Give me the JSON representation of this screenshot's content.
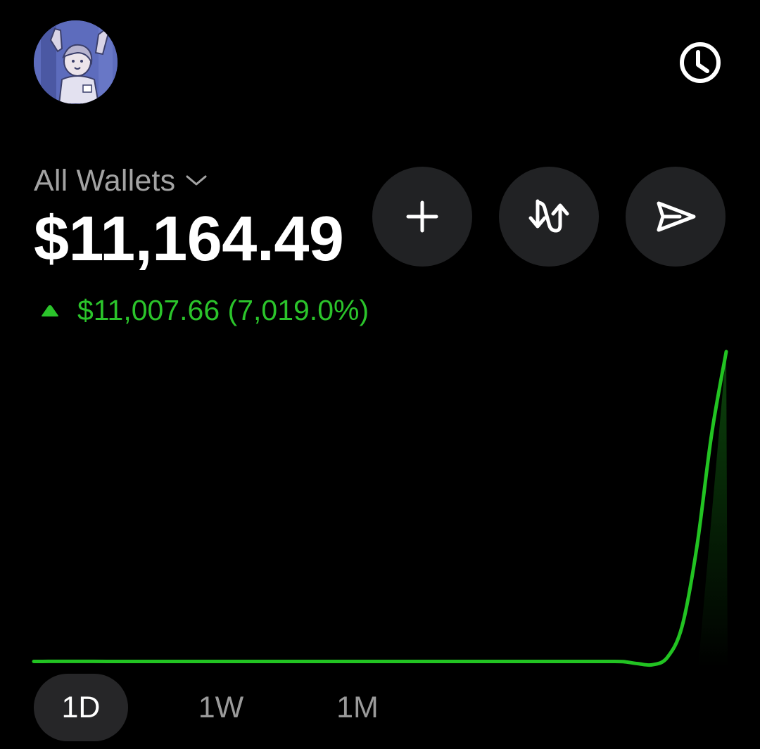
{
  "header": {
    "avatar_icon": "profile-avatar",
    "history_icon": "clock-icon"
  },
  "wallet": {
    "selector_label": "All Wallets",
    "selector_icon": "chevron-down-icon",
    "balance": "$11,164.49",
    "change_text": "$11,007.66 (7,019.0%)",
    "change_icon": "triangle-up-icon",
    "change_color": "#2bc42b"
  },
  "actions": [
    {
      "name": "add-button",
      "icon": "plus-icon"
    },
    {
      "name": "swap-button",
      "icon": "swap-arrows-icon"
    },
    {
      "name": "send-button",
      "icon": "send-icon"
    }
  ],
  "chart_data": {
    "type": "line",
    "series": [
      {
        "color": "#22c322",
        "values": [
          156.8,
          159,
          160.5,
          161,
          160.5,
          158.5,
          156.8,
          156.8,
          156.8,
          156.8,
          156.8,
          156.8,
          156.8,
          156.8,
          156.8,
          156.8,
          156.8,
          156.8,
          156.8,
          156.8,
          156.8,
          156.8,
          156.8,
          156.8,
          156.8,
          156.8,
          156.8,
          156.8,
          156.8,
          156.8,
          156.8,
          156.8,
          156.8,
          156.8,
          156.8,
          156.8,
          156.8,
          156.8,
          156.8,
          156.8,
          150,
          80,
          40,
          300,
          1400,
          4200,
          8200,
          11164.49
        ]
      }
    ],
    "grid": false,
    "legend": "none",
    "axes_visible": false
  },
  "ranges": {
    "active": "1D",
    "tabs": [
      "1D",
      "1W",
      "1M"
    ]
  }
}
